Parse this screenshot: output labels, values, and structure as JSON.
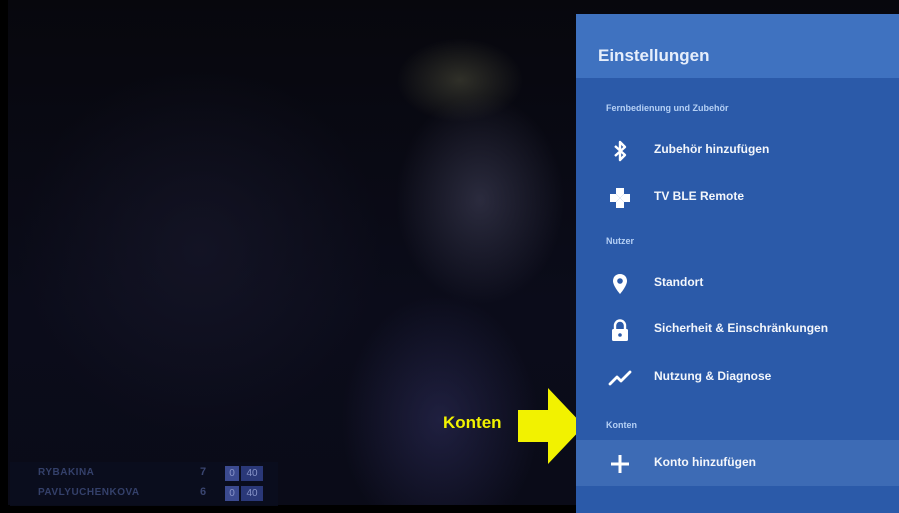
{
  "scoreboard": {
    "rows": [
      {
        "player": "RYBAKINA",
        "set": "7",
        "game": "0",
        "points": "40"
      },
      {
        "player": "PAVLYUCHENKOVA",
        "set": "6",
        "game": "0",
        "points": "40"
      }
    ]
  },
  "annotation": {
    "label": "Konten",
    "color": "#f2f200"
  },
  "settings": {
    "title": "Einstellungen",
    "sections": [
      {
        "header": "Fernbedienung und Zubehör",
        "items": [
          {
            "icon": "bluetooth-icon",
            "label": "Zubehör hinzufügen"
          },
          {
            "icon": "gamepad-icon",
            "label": "TV BLE Remote"
          }
        ]
      },
      {
        "header": "Nutzer",
        "items": [
          {
            "icon": "location-pin-icon",
            "label": "Standort"
          },
          {
            "icon": "lock-icon",
            "label": "Sicherheit & Einschränkungen"
          },
          {
            "icon": "trend-line-icon",
            "label": "Nutzung & Diagnose"
          }
        ]
      },
      {
        "header": "Konten",
        "items": [
          {
            "icon": "plus-icon",
            "label": "Konto hinzufügen",
            "selected": true
          }
        ]
      }
    ]
  },
  "colors": {
    "panel": "#2b5aa9",
    "panel_header": "#3f72c0",
    "selected_item": "#3d6bb5",
    "section_header_text": "#b5d0f5"
  }
}
